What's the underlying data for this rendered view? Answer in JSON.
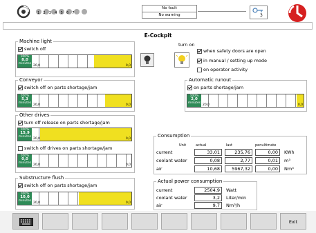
{
  "header": {
    "status_line1": "No fault",
    "status_line2": "No warning",
    "badge_value": "3",
    "dots": [
      "1",
      "2",
      "3",
      "4",
      "5",
      "6",
      "7"
    ]
  },
  "title": "E-Cockpit",
  "machine_light": {
    "legend": "Machine light",
    "switch_off": "switch off",
    "bar_top": "100%",
    "bar_val": "8,0",
    "bar_unit": "minutes",
    "bar_lo": "20,0",
    "bar_hi": "0,0"
  },
  "turn_on": {
    "label": "turn on",
    "opt1": "when safety doors are open",
    "opt2": "in manual / setting up mode",
    "opt3": "on operator activity"
  },
  "conveyor": {
    "legend": "Conveyor",
    "opt": "switch off on parts shortage/jam",
    "bar_top": "100%",
    "bar_val": "5,3",
    "bar_unit": "minutes",
    "bar_lo": "20,0",
    "bar_hi": "0,0"
  },
  "auto_runout": {
    "legend": "Automatic runout",
    "opt": "on parts shortage/jam",
    "bar_top": "100%",
    "bar_val": "2,0",
    "bar_unit": "minutes",
    "bar_lo": "20,0",
    "bar_hi": "0,0"
  },
  "other_drives": {
    "legend": "Other drives",
    "opt1": "turn off release on parts shortage/jam",
    "bar1_top": "100%",
    "bar1_val": "15,9",
    "bar1_unit": "minutes",
    "bar1_lo": "20,0",
    "bar1_hi": "0,0",
    "opt2": "switch off drives on parts shortage/jam",
    "bar2_top": "100%",
    "bar2_val": "0,0",
    "bar2_unit": "minutes",
    "bar2_lo": "20,0",
    "bar2_hi": "0,0"
  },
  "flush": {
    "legend": "Substructure flush",
    "opt": "switch off on parts shortage/jam",
    "bar_top": "100%",
    "bar_val": "10,0",
    "bar_unit": "minutes",
    "bar_lo": "20,0",
    "bar_hi": "0,0"
  },
  "consumption": {
    "legend": "Consumption",
    "headers": [
      "Unit",
      "actual",
      "last",
      "penultimate"
    ],
    "rows": [
      {
        "label": "current",
        "actual": "33,01",
        "last": "235,76",
        "pen": "0,00",
        "unit": "KWh"
      },
      {
        "label": "coolant water",
        "actual": "0,08",
        "last": "2,77",
        "pen": "0,01",
        "unit": "m³"
      },
      {
        "label": "air",
        "actual": "10,68",
        "last": "5967,32",
        "pen": "0,00",
        "unit": "Nm³"
      }
    ]
  },
  "power": {
    "legend": "Actual power consumption",
    "rows": [
      {
        "label": "current",
        "value": "2504,9",
        "unit": "Watt"
      },
      {
        "label": "coolant water",
        "value": "3,2",
        "unit": "Liter/min"
      },
      {
        "label": "air",
        "value": "9,7",
        "unit": "Nm³/h"
      }
    ]
  },
  "footer": {
    "exit": "Exit"
  }
}
